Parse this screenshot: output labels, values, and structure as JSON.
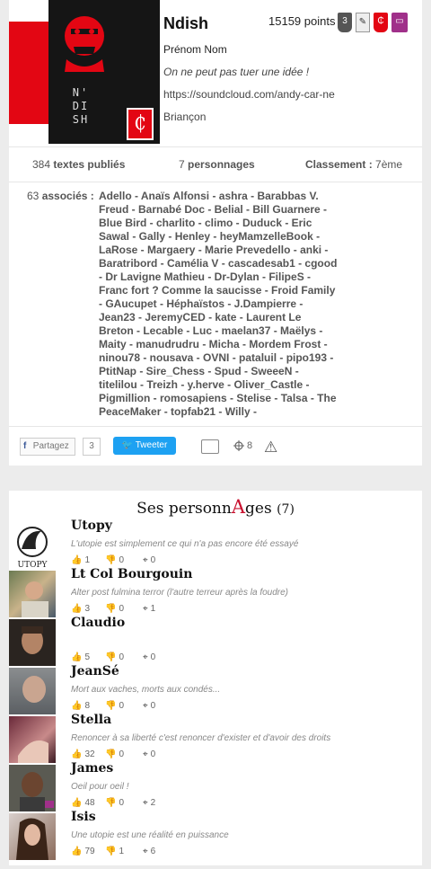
{
  "profile": {
    "name": "Ndish",
    "points": "15159 points",
    "badges": [
      "3",
      "",
      "",
      ""
    ],
    "full_name": "Prénom Nom",
    "quote": "On ne peut pas tuer une idée !",
    "url": "https://soundcloud.com/andy-car-ne",
    "city": "Briançon",
    "avatar_text": "N'\nDI\nSH",
    "avatar_logo": "₵"
  },
  "stats": {
    "texts_count": "384",
    "texts_label": "textes publiés",
    "chars_count": "7",
    "chars_label": "personnages",
    "rank_label": "Classement :",
    "rank_value": "7ème"
  },
  "associates": {
    "label_count": "63",
    "label": "associés :",
    "names": "Adello - Anaïs Alfonsi - ashra - Barabbas V. Freud - Barnabé Doc - Belial - Bill Guarnere - Blue Bird - charlito - climo - Duduck - Eric Sawal - Gally - Henley - heyMamzelleBook - LaRose - Margaery - Marie Prevedello - anki - Baratribord - Camélia V - cascadesab1 - cgood - Dr Lavigne Mathieu - Dr-Dylan - FilipeS - Franc fort ? Comme la saucisse - Froid Family - GAucupet - Héphaïstos - J.Dampierre - Jean23 - JeremyCED - kate - Laurent Le Breton - Lecable - Luc - maelan37 - Maëlys - Maity - manudrudru - Micha - Mordem Frost - ninou78 - nousava - OVNI - pataluil - pipo193 - PtitNap - Sire_Chess - Spud - SweeeN - titelilou - Treizh - y.herve - Oliver_Castle - Pigmillion - romosapiens - Stelise - Talsa - The PeaceMaker - topfab21 - Willy -"
  },
  "share": {
    "facebook_label": "Partagez",
    "facebook_count": "3",
    "tweet_label": "Tweeter",
    "target_count": "8"
  },
  "characters_section": {
    "title_pre": "Ses personn",
    "title_A": "A",
    "title_post": "ges",
    "count": "(7)"
  },
  "characters": [
    {
      "name": "Utopy",
      "quote": "L'utopie est simplement ce qui n'a pas encore été essayé",
      "likes": "1",
      "dislikes": "0",
      "targets": "0"
    },
    {
      "name": "Lt Col Bourgouin",
      "quote": "Alter post fulmina terror (l'autre terreur après la foudre)",
      "likes": "3",
      "dislikes": "0",
      "targets": "1"
    },
    {
      "name": "Claudio",
      "quote": "",
      "likes": "5",
      "dislikes": "0",
      "targets": "0"
    },
    {
      "name": "JeanSé",
      "quote": "Mort aux vaches, morts aux condés...",
      "likes": "8",
      "dislikes": "0",
      "targets": "0"
    },
    {
      "name": "Stella",
      "quote": "Renoncer à sa liberté c'est renoncer d'exister et d'avoir des droits",
      "likes": "32",
      "dislikes": "0",
      "targets": "0"
    },
    {
      "name": "James",
      "quote": "Oeil pour oeil !",
      "likes": "48",
      "dislikes": "0",
      "targets": "2"
    },
    {
      "name": "Isis",
      "quote": "Une utopie est une réalité en puissance",
      "likes": "79",
      "dislikes": "1",
      "targets": "6"
    }
  ],
  "utopy_thumb_text": "UTOPY",
  "colors": {
    "brand_red": "#e30613",
    "tweet_blue": "#1da1f2",
    "badge_purple": "#a0308a"
  }
}
